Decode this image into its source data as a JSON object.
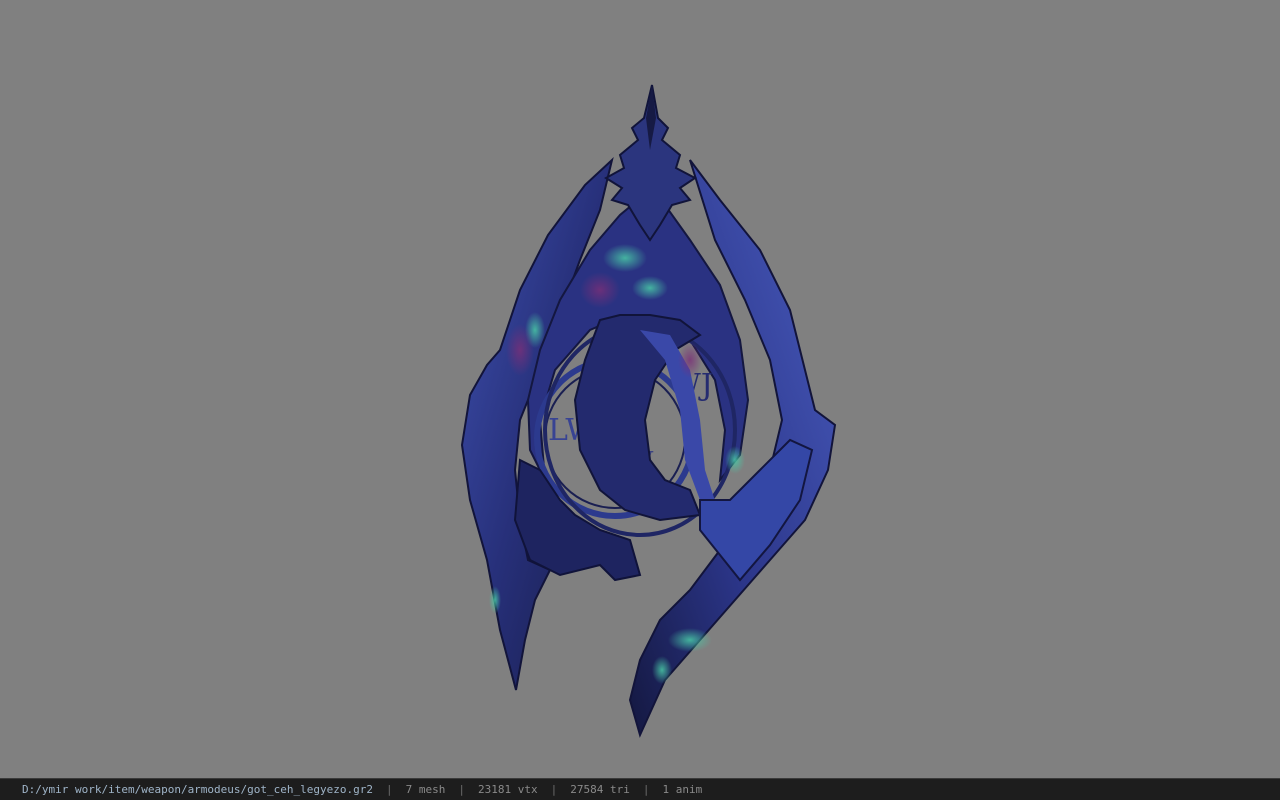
{
  "viewer": {
    "background_color": "#808080",
    "model_name": "got_ceh_legyezo.gr2"
  },
  "status": {
    "file_path": "D:/ymir work/item/weapon/armodeus/got_ceh_legyezo.gr2",
    "separator": "|",
    "mesh_count": "7 mesh",
    "vertex_count": "23181 vtx",
    "triangle_count": "27584 tri",
    "anim_count": "1 anim"
  },
  "colors": {
    "model_dark": "#1b1f4a",
    "model_mid": "#2f3b8c",
    "model_light": "#4e63c2",
    "model_glow": "#3fb59a",
    "model_purple": "#5a2a6e",
    "statusbar_bg": "#1d1d1d"
  }
}
